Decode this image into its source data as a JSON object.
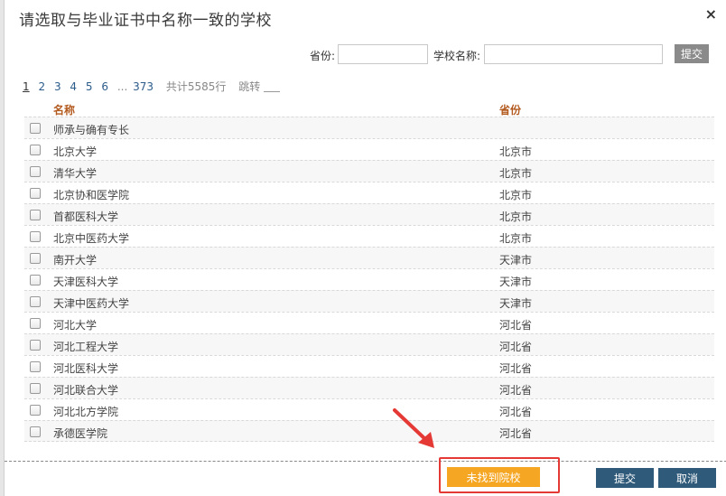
{
  "dialog": {
    "title": "请选取与毕业证书中名称一致的学校",
    "close_icon": "close-icon",
    "close_glyph": "×"
  },
  "search": {
    "province_label": "省份:",
    "province_value": "",
    "school_label": "学校名称:",
    "school_value": "",
    "submit_label": "提交"
  },
  "pager": {
    "pages": [
      "1",
      "2",
      "3",
      "4",
      "5",
      "6"
    ],
    "current": "1",
    "ellipsis": "...",
    "last": "373",
    "total": "共计5585行",
    "jump_label": "跳转"
  },
  "table": {
    "headers": {
      "name": "名称",
      "province": "省份"
    },
    "rows": [
      {
        "name": "师承与确有专长",
        "province": ""
      },
      {
        "name": "北京大学",
        "province": "北京市"
      },
      {
        "name": "清华大学",
        "province": "北京市"
      },
      {
        "name": "北京协和医学院",
        "province": "北京市"
      },
      {
        "name": "首都医科大学",
        "province": "北京市"
      },
      {
        "name": "北京中医药大学",
        "province": "北京市"
      },
      {
        "name": "南开大学",
        "province": "天津市"
      },
      {
        "name": "天津医科大学",
        "province": "天津市"
      },
      {
        "name": "天津中医药大学",
        "province": "天津市"
      },
      {
        "name": "河北大学",
        "province": "河北省"
      },
      {
        "name": "河北工程大学",
        "province": "河北省"
      },
      {
        "name": "河北医科大学",
        "province": "河北省"
      },
      {
        "name": "河北联合大学",
        "province": "河北省"
      },
      {
        "name": "河北北方学院",
        "province": "河北省"
      },
      {
        "name": "承德医学院",
        "province": "河北省"
      }
    ]
  },
  "footer": {
    "not_found_label": "未找到院校",
    "submit_label": "提交",
    "cancel_label": "取消"
  },
  "colors": {
    "accent_orange": "#f5a623",
    "button_blue": "#2f5a7a",
    "highlight_red": "#e53935",
    "header_text": "#b35a1f"
  }
}
